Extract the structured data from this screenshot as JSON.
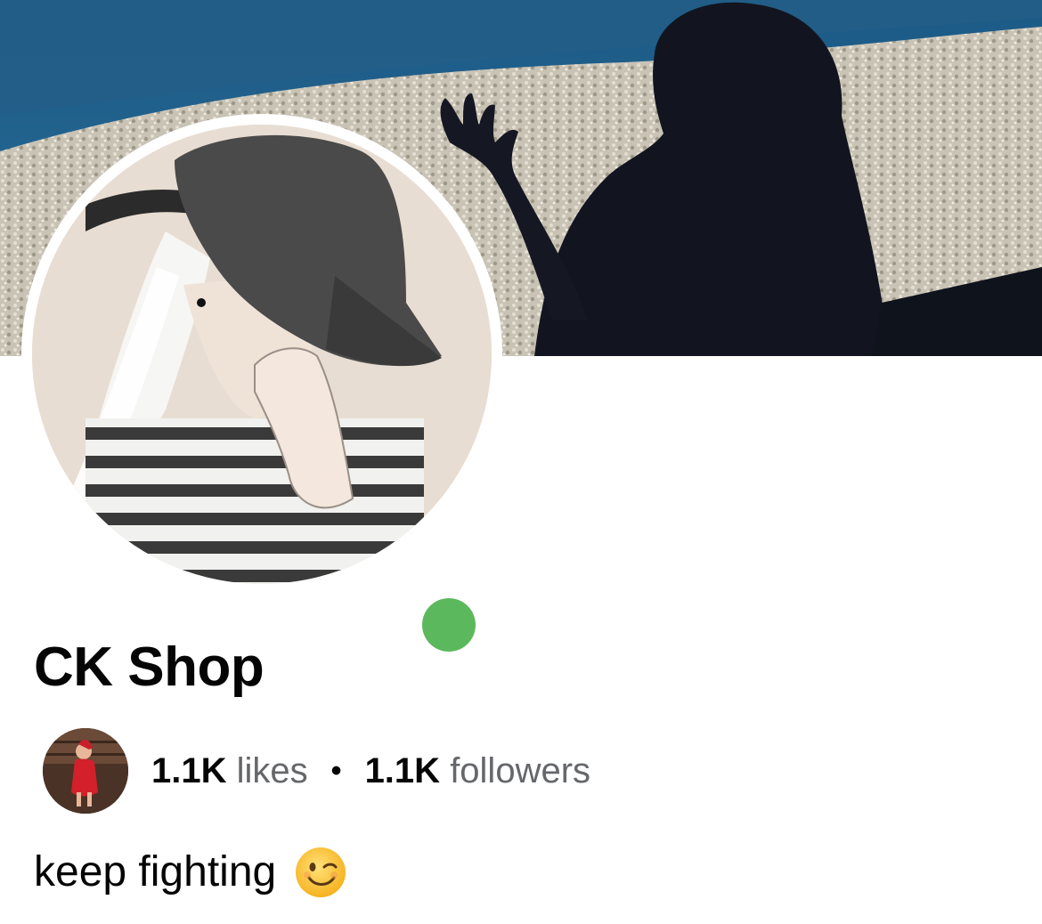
{
  "profile": {
    "name": "CK Shop",
    "likes_count": "1.1K",
    "likes_label": "likes",
    "separator": "•",
    "followers_count": "1.1K",
    "followers_label": "followers",
    "bio_text": "keep fighting",
    "bio_emoji": "winking-face",
    "online": true
  },
  "colors": {
    "online": "#5cb85c",
    "text_primary": "#050505",
    "text_secondary": "#65676b"
  }
}
